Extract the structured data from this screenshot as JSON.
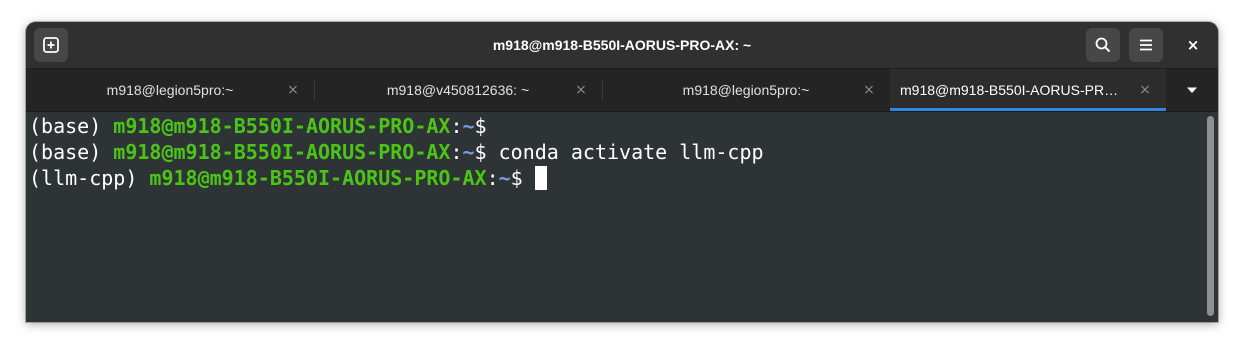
{
  "window": {
    "title": "m918@m918-B550I-AORUS-PRO-AX: ~"
  },
  "headerbar": {
    "new_tab_icon": "new-tab-icon",
    "search_icon": "search-icon",
    "menu_icon": "hamburger-menu-icon",
    "close_label": "×"
  },
  "tabs": [
    {
      "label": "m918@legion5pro:~",
      "close": "×",
      "active": false
    },
    {
      "label": "m918@v450812636: ~",
      "close": "×",
      "active": false
    },
    {
      "label": "m918@legion5pro:~",
      "close": "×",
      "active": false
    },
    {
      "label": "m918@m918-B550I-AORUS-PRO-AX: ~",
      "close": "×",
      "active": true
    }
  ],
  "tab_menu_icon": "dropdown-arrow-icon",
  "terminal": {
    "lines": [
      {
        "env": "(base) ",
        "user_host": "m918@m918-B550I-AORUS-PRO-AX",
        "colon": ":",
        "path": "~",
        "prompt": "$",
        "command": ""
      },
      {
        "env": "(base) ",
        "user_host": "m918@m918-B550I-AORUS-PRO-AX",
        "colon": ":",
        "path": "~",
        "prompt": "$",
        "command": " conda activate llm-cpp"
      },
      {
        "env": "(llm-cpp) ",
        "user_host": "m918@m918-B550I-AORUS-PRO-AX",
        "colon": ":",
        "path": "~",
        "prompt": "$",
        "command": ""
      }
    ]
  },
  "colors": {
    "terminal_bg": "#2e3436",
    "prompt_green": "#4cc417",
    "path_blue": "#7b99e6",
    "tab_accent": "#3584e4"
  }
}
